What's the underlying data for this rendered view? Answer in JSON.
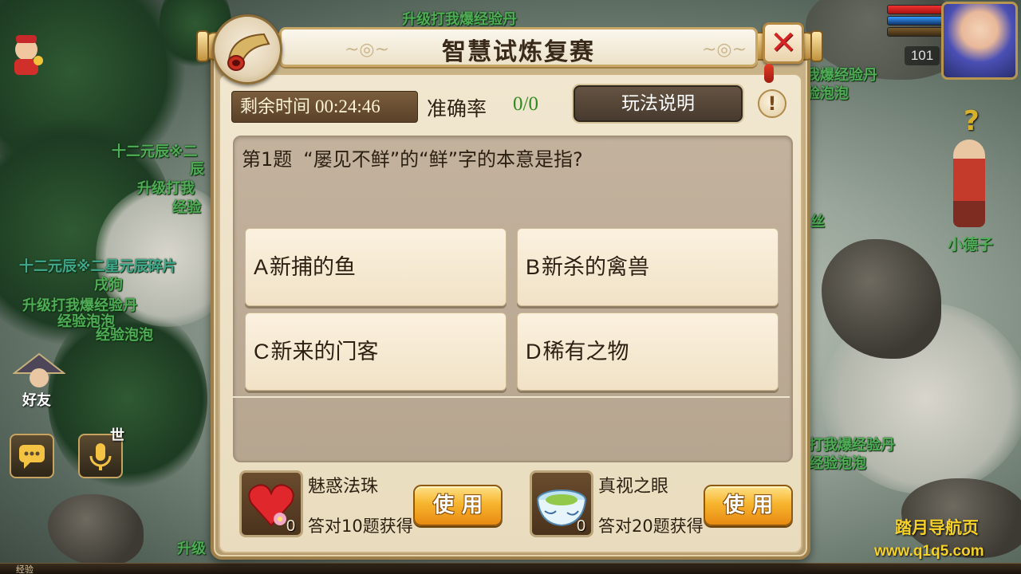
{
  "dialog": {
    "title": "智慧试炼复赛",
    "close_glyph": "✕",
    "time_label": "剩余时间",
    "time_value": "00:24:46",
    "accuracy_label": "准确率",
    "accuracy_value": "0/0",
    "rules_button": "玩法说明",
    "info_glyph": "!"
  },
  "question": {
    "number": "第1题",
    "text": "“屡见不鲜”的“鲜”字的本意是指?",
    "options": [
      {
        "letter": "A",
        "text": "新捕的鱼"
      },
      {
        "letter": "B",
        "text": "新杀的禽兽"
      },
      {
        "letter": "C",
        "text": "新来的门客"
      },
      {
        "letter": "D",
        "text": "稀有之物"
      }
    ]
  },
  "items": [
    {
      "name": "魅惑法珠",
      "icon": "heart-charm-icon",
      "count": "0",
      "desc": "答对10题获得",
      "use_label": "使用"
    },
    {
      "name": "真视之眼",
      "icon": "eye-bowl-icon",
      "count": "0",
      "desc": "答对20题获得",
      "use_label": "使用"
    }
  ],
  "hud": {
    "level": "101",
    "friend_label": "好友",
    "world_label": "世",
    "exp_label": "经验",
    "npc_name": "小德子",
    "npc_quest_glyph": "?"
  },
  "floating_texts": [
    "升级打我爆经验丹",
    "十二元辰※二",
    "辰",
    "升级打我",
    "经验",
    "十二元辰※二星元辰碎片",
    "戌狗",
    "升级打我爆经验丹",
    "经验泡泡",
    "经验泡泡",
    "我爆经验丹",
    "验泡泡",
    "丝",
    "打我爆经验丹",
    "经验泡泡",
    "升级"
  ],
  "watermark": {
    "line1": "踏月导航页",
    "line2": "www.q1q5.com"
  },
  "colors": {
    "accent_green": "#2f8a20",
    "close_red": "#d42424",
    "use_button_orange": "#f7b52e",
    "floating_text_green": "#4fae55",
    "watermark_yellow": "#f5d12a"
  }
}
